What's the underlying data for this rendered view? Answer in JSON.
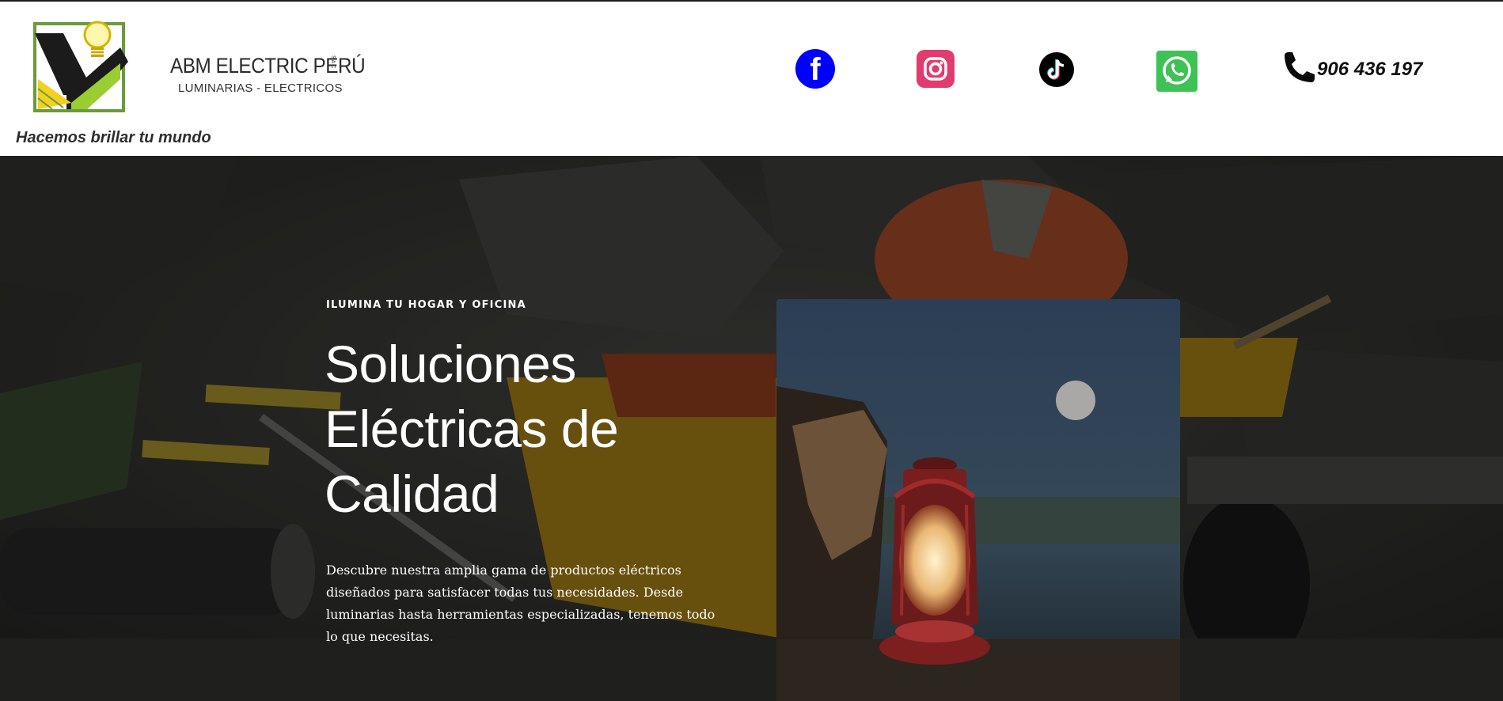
{
  "header": {
    "logo": {
      "brand": "ABM ELECTRIC PERÚ",
      "brand_suffix": "SAC",
      "subtitle": "LUMINARIAS - ELECTRICOS"
    },
    "tagline": "Hacemos brillar tu mundo",
    "social": [
      {
        "icon": "facebook-icon",
        "color": "#0000ff"
      },
      {
        "icon": "instagram-icon",
        "color": "#e13b6f"
      },
      {
        "icon": "tiktok-icon",
        "color": "#000000"
      },
      {
        "icon": "whatsapp-icon",
        "color": "#3ec155"
      }
    ],
    "phone": "906 436 197"
  },
  "hero": {
    "eyebrow": "ILUMINA TU HOGAR Y OFICINA",
    "title_lines": [
      "Soluciones",
      "Eléctricas de",
      "Calidad"
    ],
    "description": "Descubre nuestra amplia gama de productos eléctricos diseñados para satisfacer todas tus necesidades. Desde luminarias hasta herramientas especializadas, tenemos todo lo que necesitas."
  }
}
